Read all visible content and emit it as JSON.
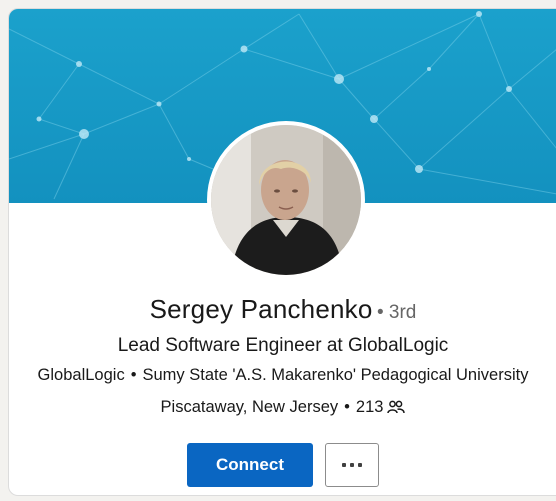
{
  "profile": {
    "name": "Sergey Panchenko",
    "degree": "• 3rd",
    "headline": "Lead Software Engineer at GlobalLogic",
    "company": "GlobalLogic",
    "org_separator": "•",
    "education": "Sumy State 'A.S. Makarenko' Pedagogical University",
    "location": "Piscataway, New Jersey",
    "loc_separator": "•",
    "connections_count": "213"
  },
  "actions": {
    "connect_label": "Connect",
    "more_icon": "ellipsis-icon"
  },
  "icons": {
    "connections": "people-icon"
  },
  "colors": {
    "banner": "#1a9bc9",
    "primary_button": "#0a66c2",
    "text": "#191919",
    "muted": "#666666"
  }
}
